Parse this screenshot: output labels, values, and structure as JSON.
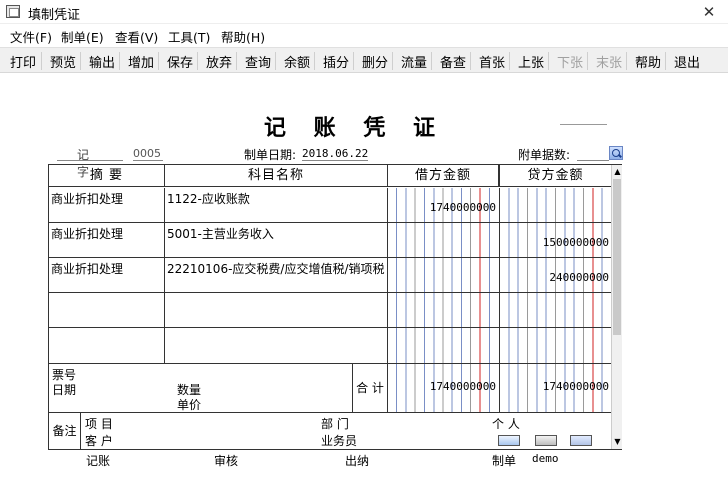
{
  "window": {
    "title": "填制凭证",
    "close_glyph": "✕"
  },
  "menu": [
    "文件(F)",
    "制单(E)",
    "查看(V)",
    "工具(T)",
    "帮助(H)"
  ],
  "toolbar": {
    "buttons": [
      {
        "label": "打印",
        "enabled": true
      },
      {
        "label": "预览",
        "enabled": true
      },
      {
        "label": "输出",
        "enabled": true
      },
      {
        "label": "增加",
        "enabled": true
      },
      {
        "label": "保存",
        "enabled": true
      },
      {
        "label": "放弃",
        "enabled": true
      },
      {
        "label": "查询",
        "enabled": true
      },
      {
        "label": "余额",
        "enabled": true
      },
      {
        "label": "插分",
        "enabled": true
      },
      {
        "label": "删分",
        "enabled": true
      },
      {
        "label": "流量",
        "enabled": true
      },
      {
        "label": "备查",
        "enabled": true
      },
      {
        "label": "首张",
        "enabled": true
      },
      {
        "label": "上张",
        "enabled": true
      },
      {
        "label": "下张",
        "enabled": false
      },
      {
        "label": "末张",
        "enabled": false
      },
      {
        "label": "帮助",
        "enabled": true
      },
      {
        "label": "退出",
        "enabled": true
      }
    ]
  },
  "voucher": {
    "title": "记 账 凭 证",
    "type_label": "记  字",
    "number": "0005",
    "date_label": "制单日期:",
    "date": "2018.06.22",
    "attachments_label": "附单据数:",
    "headers": {
      "summary": "摘  要",
      "account": "科目名称",
      "debit": "借方金额",
      "credit": "贷方金额"
    },
    "rows": [
      {
        "summary": "商业折扣处理",
        "account": "1122-应收账款",
        "debit": "1740000000",
        "credit": ""
      },
      {
        "summary": "商业折扣处理",
        "account": "5001-主营业务收入",
        "debit": "",
        "credit": "1500000000"
      },
      {
        "summary": "商业折扣处理",
        "account": "22210106-应交税费/应交增值税/销项税",
        "debit": "",
        "credit": "240000000"
      },
      {
        "summary": "",
        "account": "",
        "debit": "",
        "credit": ""
      },
      {
        "summary": "",
        "account": "",
        "debit": "",
        "credit": ""
      }
    ],
    "ticket_label": "票号",
    "ticket_date_label": "日期",
    "quantity_label": "数量",
    "price_label": "单价",
    "total_label": "合 计",
    "total_debit": "1740000000",
    "total_credit": "1740000000",
    "notes_label": "备注",
    "project_label": "项  目",
    "department_label": "部  门",
    "person_label": "个  人",
    "customer_label": "客  户",
    "salesperson_label": "业务员"
  },
  "footer": {
    "bookkeeper_label": "记账",
    "auditor_label": "审核",
    "cashier_label": "出纳",
    "maker_label": "制单",
    "maker_name": "demo"
  },
  "colors": {
    "grid_blue": "#7a8fc6",
    "grid_red": "#d02020",
    "grid_gray": "#9a9a9a"
  }
}
